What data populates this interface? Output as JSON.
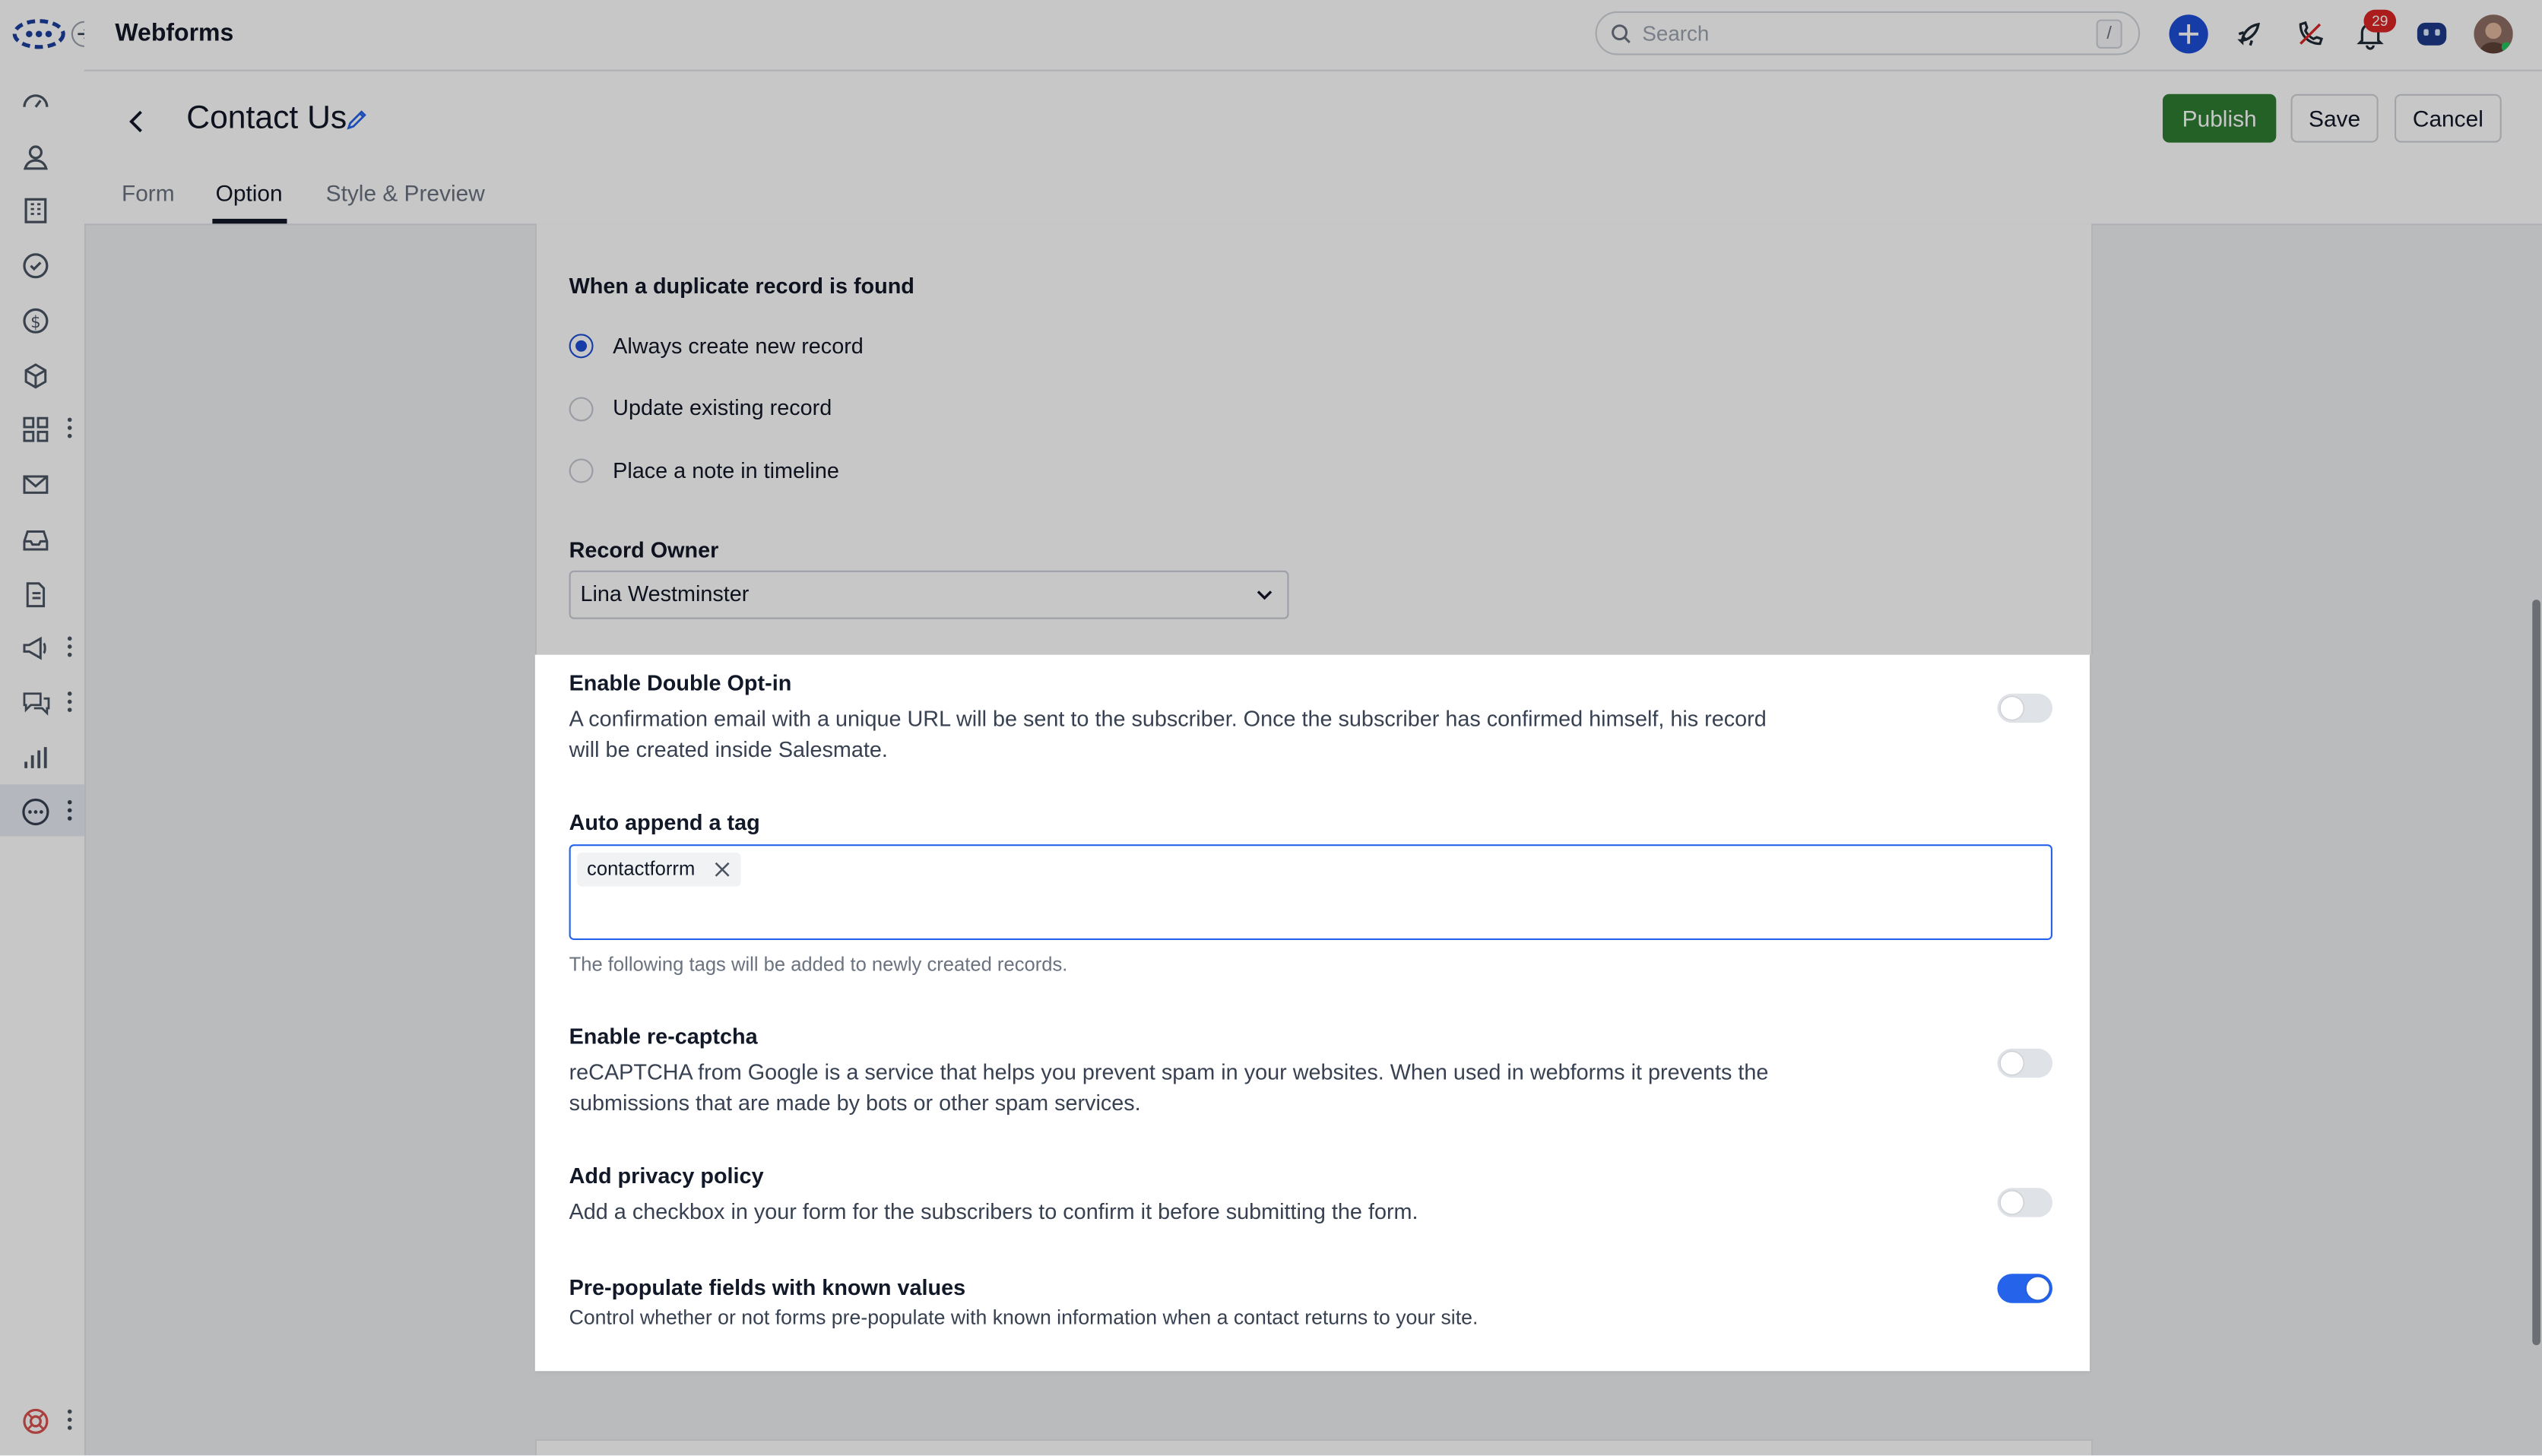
{
  "app": {
    "title": "Webforms"
  },
  "search": {
    "placeholder": "Search",
    "shortcut": "/"
  },
  "notifications": {
    "count": "29"
  },
  "page": {
    "title": "Contact Us",
    "buttons": {
      "publish": "Publish",
      "save": "Save",
      "cancel": "Cancel"
    },
    "tabs": [
      {
        "label": "Form",
        "active": false
      },
      {
        "label": "Option",
        "active": true
      },
      {
        "label": "Style & Preview",
        "active": false
      }
    ]
  },
  "duplicate": {
    "heading": "When a duplicate record is found",
    "options": [
      {
        "label": "Always create new record",
        "selected": true
      },
      {
        "label": "Update existing record",
        "selected": false
      },
      {
        "label": "Place a note in timeline",
        "selected": false
      }
    ]
  },
  "record_owner": {
    "label": "Record Owner",
    "value": "Lina Westminster"
  },
  "settings": {
    "double_optin": {
      "title": "Enable Double Opt-in",
      "description": "A confirmation email with a unique URL will be sent to the subscriber. Once the subscriber has confirmed himself, his record will be created inside Salesmate.",
      "enabled": false
    },
    "auto_tag": {
      "title": "Auto append a tag",
      "tags": [
        "contactforrm"
      ],
      "hint": "The following tags will be added to newly created records."
    },
    "recaptcha": {
      "title": "Enable re-captcha",
      "description": "reCAPTCHA from Google is a service that helps you prevent spam in your websites. When used in webforms it prevents the submissions that are made by bots or other spam services.",
      "enabled": false
    },
    "privacy": {
      "title": "Add privacy policy",
      "description": "Add a checkbox in your form for the subscribers to confirm it before submitting the form.",
      "enabled": false
    },
    "prepopulate": {
      "title": "Pre-populate fields with known values",
      "description": "Control whether or not forms pre-populate with known information when a contact returns to your site.",
      "enabled": true
    }
  },
  "sidebar": {
    "icons": [
      "dashboard-icon",
      "contacts-icon",
      "companies-icon",
      "tasks-icon",
      "deals-icon",
      "products-icon",
      "apps-icon",
      "email-icon",
      "inbox-icon",
      "sequences-icon",
      "campaigns-icon",
      "chat-icon",
      "reports-icon",
      "more-icon",
      "help-icon"
    ]
  },
  "colors": {
    "accent": "#2563eb",
    "publish": "#2e7d32",
    "badge": "#dc2626"
  }
}
